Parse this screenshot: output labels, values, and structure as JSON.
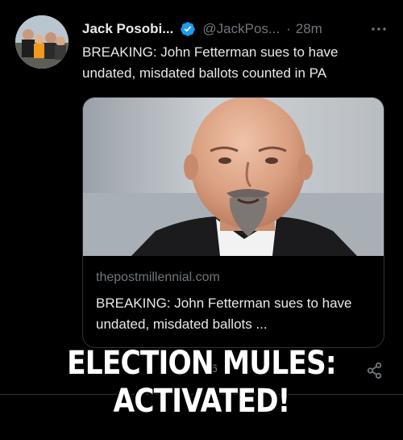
{
  "tweet": {
    "author_name": "Jack Posobi...",
    "handle": "@JackPos...",
    "separator": "·",
    "time": "28m",
    "text": "BREAKING: John Fetterman sues to have undated, misdated ballots counted in PA",
    "verified_icon": "verified-badge-icon",
    "more_icon": "more-options-icon"
  },
  "card": {
    "domain": "thepostmillennial.com",
    "title": "BREAKING: John Fetterman sues to have undated, misdated ballots ..."
  },
  "actions": {
    "partial_count": "6",
    "share_icon": "share-icon"
  },
  "meme": {
    "line1": "ELECTION MULES:",
    "line2": "ACTIVATED!"
  },
  "colors": {
    "background": "#000000",
    "text": "#e7e9ea",
    "muted": "#71767b",
    "verified": "#1d9bf0",
    "border": "#2f3336"
  }
}
